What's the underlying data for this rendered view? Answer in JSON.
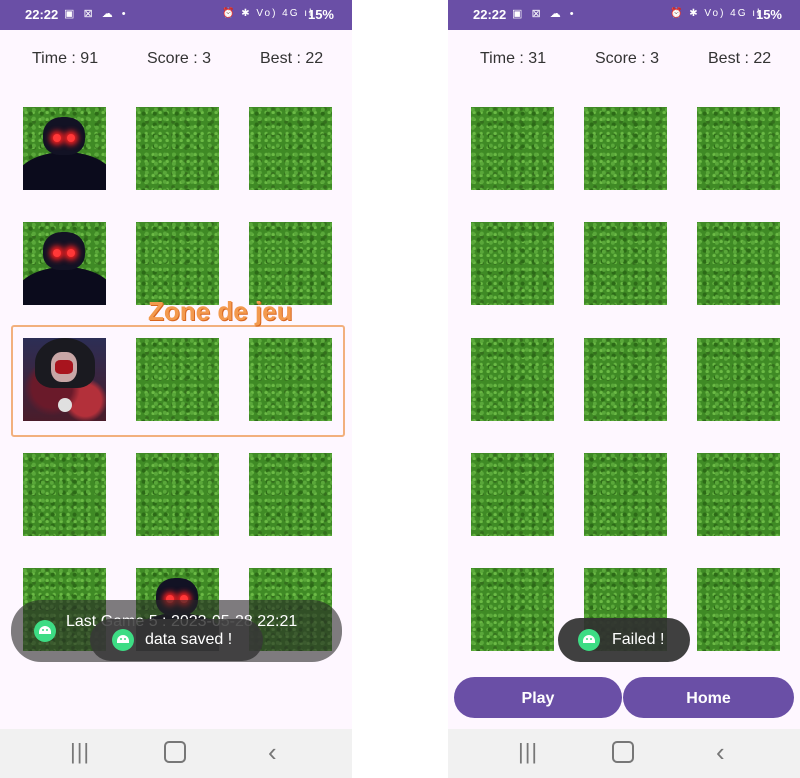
{
  "screens": [
    {
      "status": {
        "time": "22:22",
        "battery": "15%",
        "left_icons": "▣ ⊠ ☁ •",
        "right_icons": "⏰ ✱ Vo) 4G ıl"
      },
      "score": {
        "time": "Time : 91",
        "score": "Score : 3",
        "best": "Best : 22"
      },
      "grid": [
        [
          "monster-shadow",
          "grass",
          "grass"
        ],
        [
          "monster-shadow",
          "grass",
          "grass"
        ],
        [
          "monster-red",
          "grass",
          "grass"
        ],
        [
          "grass",
          "grass",
          "grass"
        ],
        [
          "grass",
          "monster-shadow",
          "grass"
        ]
      ],
      "annotation": {
        "label": "Zone de jeu"
      },
      "toasts": {
        "last_game": "Last Game 5 : 2023-05-28 22:21",
        "data_saved": "data saved !"
      }
    },
    {
      "status": {
        "time": "22:22",
        "battery": "15%",
        "left_icons": "▣ ⊠ ☁ •",
        "right_icons": "⏰ ✱ Vo) 4G ıl"
      },
      "score": {
        "time": "Time : 31",
        "score": "Score : 3",
        "best": "Best : 22"
      },
      "grid": [
        [
          "grass",
          "grass",
          "grass"
        ],
        [
          "grass",
          "grass",
          "grass"
        ],
        [
          "grass",
          "grass",
          "grass"
        ],
        [
          "grass",
          "grass",
          "grass"
        ],
        [
          "grass",
          "grass",
          "grass"
        ]
      ],
      "toast": "Failed !",
      "buttons": {
        "play": "Play",
        "home": "Home"
      }
    }
  ],
  "navbar": {
    "recent": "|||",
    "home": "home-icon",
    "back": "‹"
  },
  "colors": {
    "accent": "#6a4fa6",
    "grass": "#3f8a25",
    "zone_border": "#f2b07d",
    "zone_text": "#f39a4e"
  }
}
